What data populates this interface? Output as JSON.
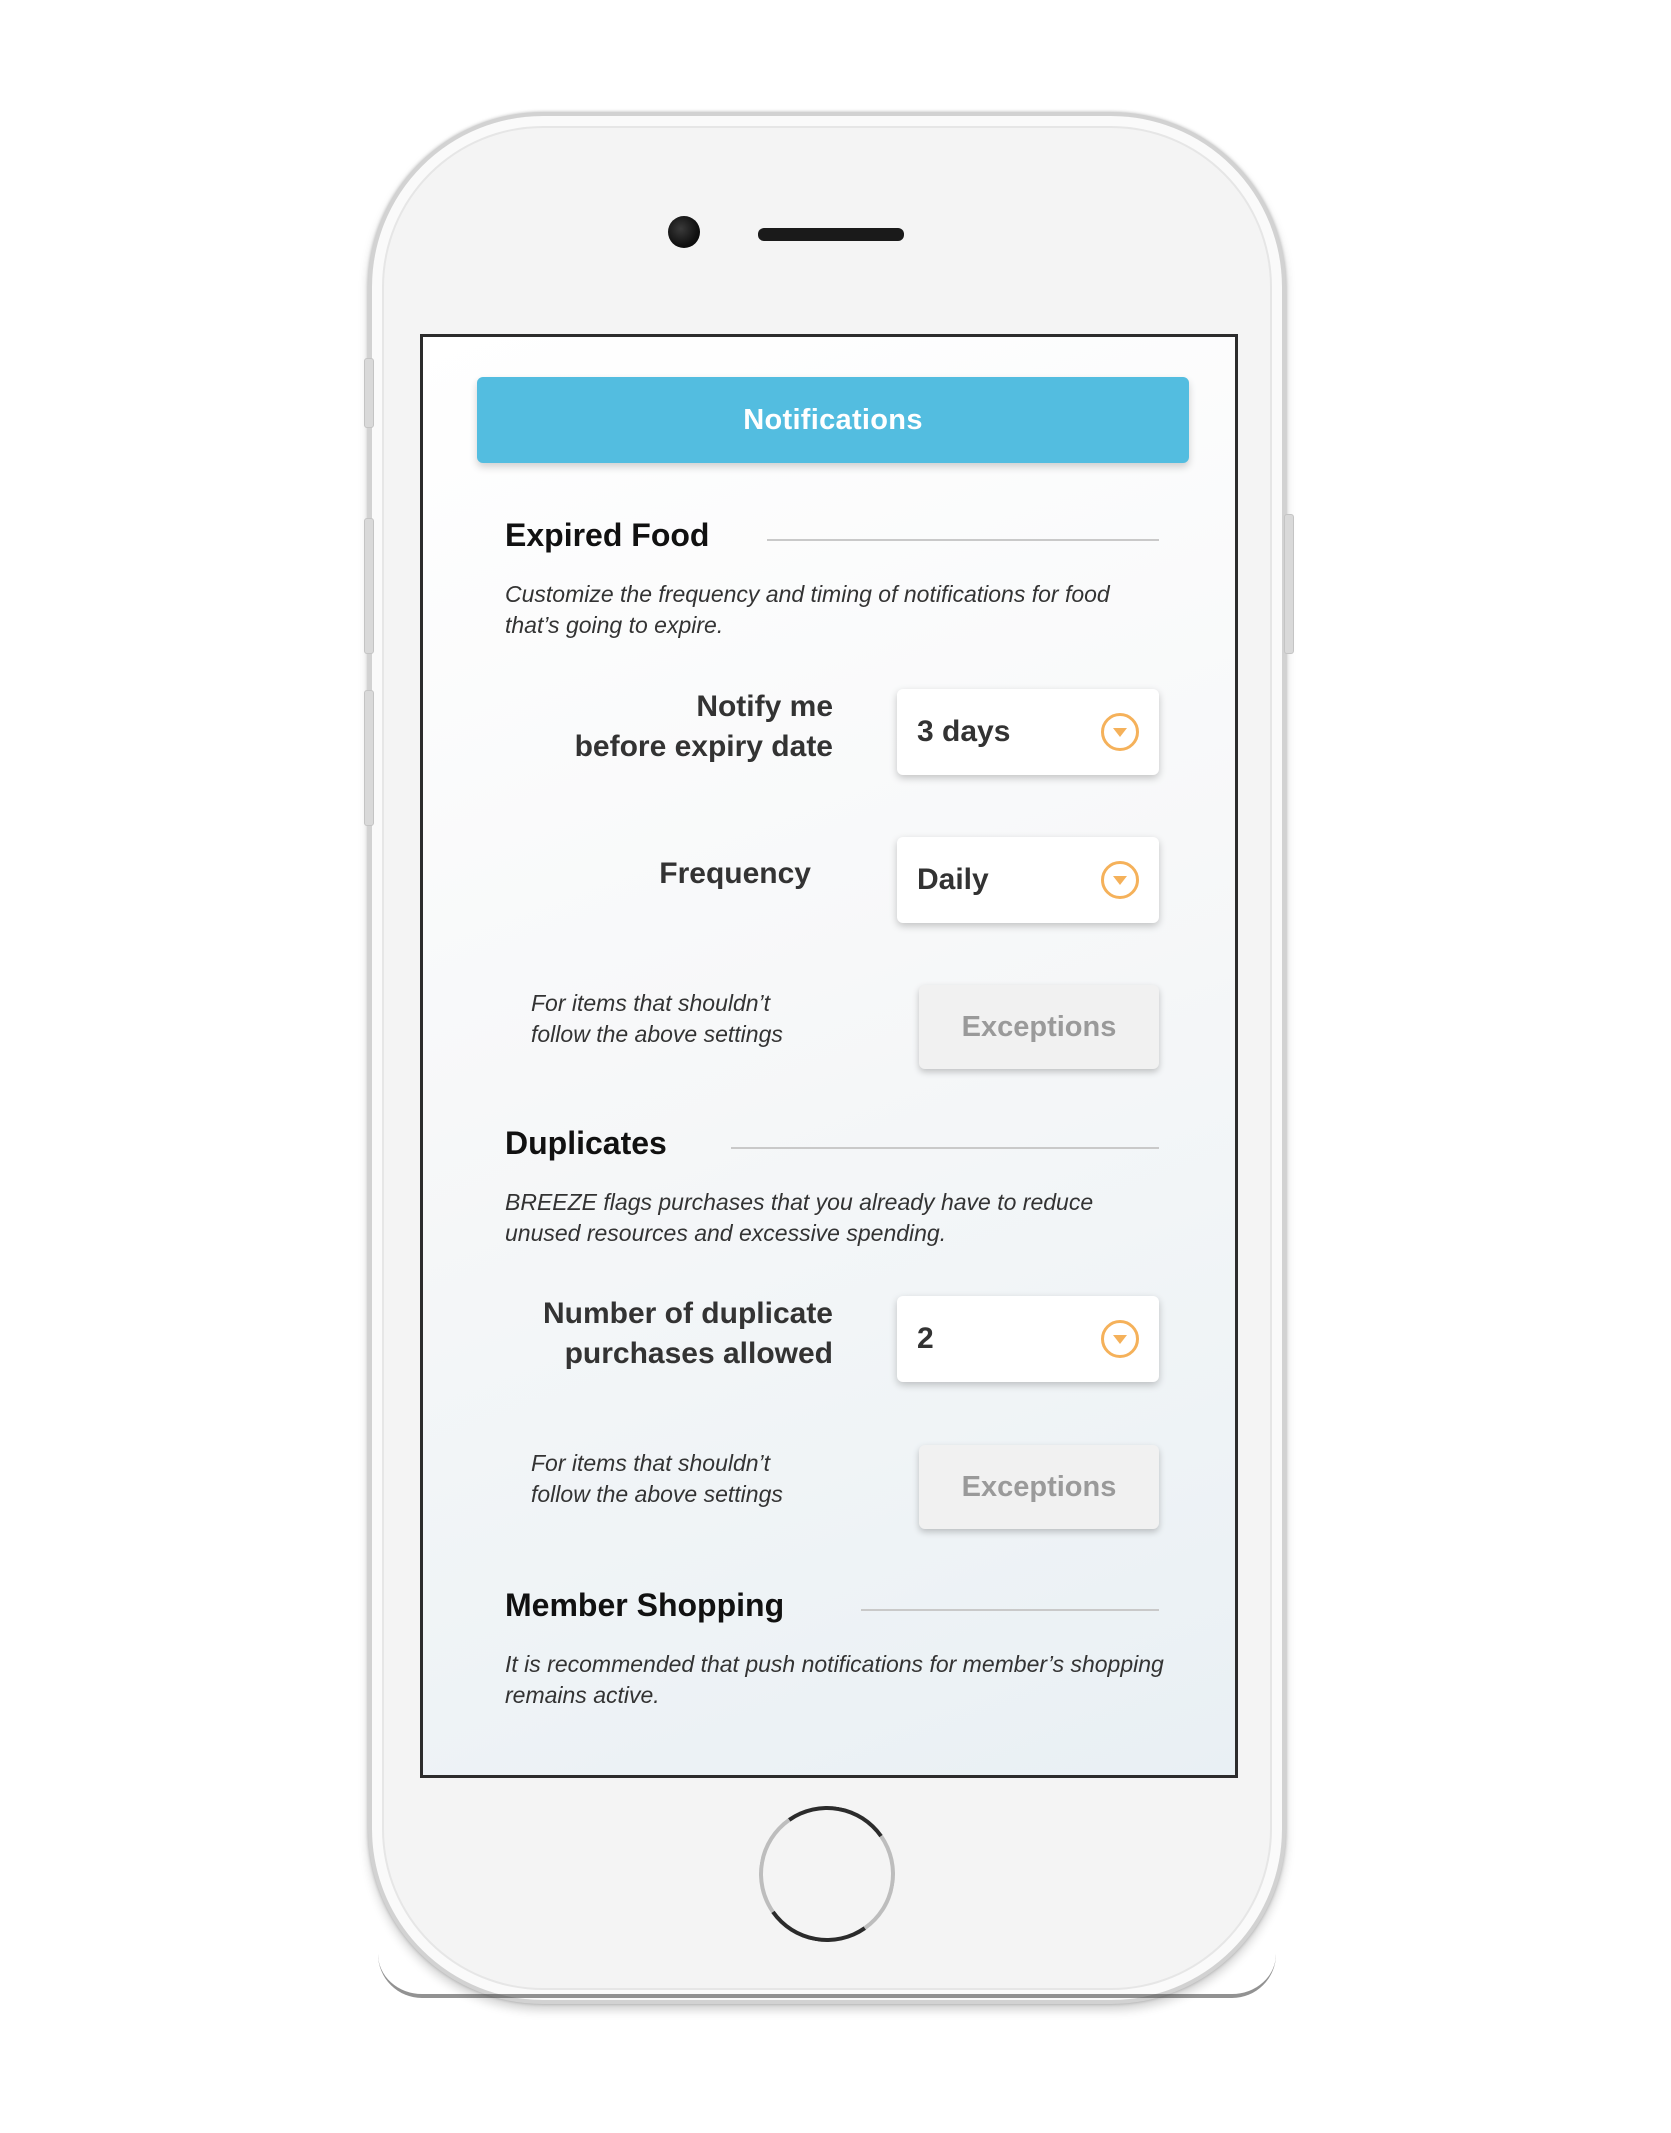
{
  "header": {
    "title": "Notifications",
    "color": "#53bde0"
  },
  "expired_food": {
    "title": "Expired Food",
    "description": "Customize the frequency and timing of notifications for food that’s going to expire.",
    "notify": {
      "label_line1": "Notify me",
      "label_line2": "before expiry date",
      "value": "3 days"
    },
    "frequency": {
      "label": "Frequency",
      "value": "Daily"
    },
    "exceptions": {
      "hint_line1": "For items that shouldn’t",
      "hint_line2": "follow the above settings",
      "button_label": "Exceptions"
    }
  },
  "duplicates": {
    "title": "Duplicates",
    "description": "BREEZE flags purchases that you already have to reduce unused resources and excessive spending.",
    "count": {
      "label_line1": "Number of duplicate",
      "label_line2": "purchases allowed",
      "value": "2"
    },
    "exceptions": {
      "hint_line1": "For items that shouldn’t",
      "hint_line2": "follow the above settings",
      "button_label": "Exceptions"
    }
  },
  "member_shopping": {
    "title": "Member Shopping",
    "description": "It is recommended that push notifications for member’s shopping remains active."
  },
  "icons": {
    "dropdown": "chevron-down-circle-icon",
    "accent_color": "#f5b15a"
  }
}
